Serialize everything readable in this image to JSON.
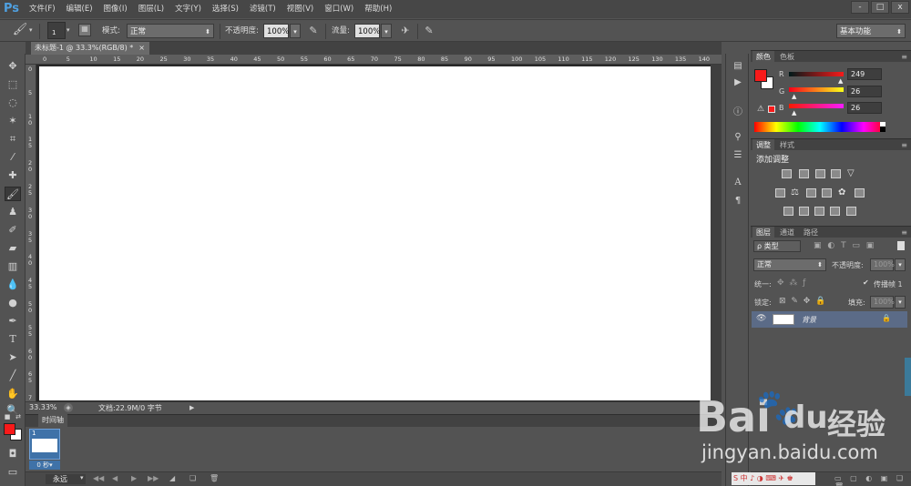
{
  "app": {
    "logo": "Ps"
  },
  "menu": [
    "文件(F)",
    "编辑(E)",
    "图像(I)",
    "图层(L)",
    "文字(Y)",
    "选择(S)",
    "滤镜(T)",
    "视图(V)",
    "窗口(W)",
    "帮助(H)"
  ],
  "window_controls": [
    "-",
    "□",
    "x"
  ],
  "options": {
    "brush_size": "1",
    "mode_label": "模式:",
    "mode_value": "正常",
    "opacity_label": "不透明度:",
    "opacity_value": "100%",
    "flow_label": "流量:",
    "flow_value": "100%",
    "workspace": "基本功能"
  },
  "document": {
    "tab_title": "未标题-1 @ 33.3%(RGB/8) *",
    "tab_close": "×"
  },
  "ruler": {
    "h_labels": [
      "0",
      "5",
      "10",
      "15",
      "20",
      "25",
      "30",
      "35",
      "40",
      "45",
      "50",
      "55",
      "60",
      "65",
      "70",
      "75",
      "80",
      "85",
      "90",
      "95",
      "100",
      "105",
      "110",
      "115",
      "120",
      "125",
      "130",
      "135",
      "140",
      "14"
    ],
    "v_labels": [
      "0",
      "5",
      "1\n0",
      "1\n5",
      "2\n0",
      "2\n5",
      "3\n0",
      "3\n5",
      "4\n0",
      "4\n5",
      "5\n0",
      "5\n5",
      "6\n0",
      "6\n5",
      "7\n0"
    ]
  },
  "status": {
    "zoom": "33.33%",
    "doc_info": "文档:22.9M/0 字节"
  },
  "timeline": {
    "tab": "时间轴",
    "frame_number": "1",
    "frame_delay": "0 秒▾",
    "loop": "永远"
  },
  "color_panel": {
    "tabs": [
      "颜色",
      "色板"
    ],
    "channels": [
      {
        "label": "R",
        "value": "249"
      },
      {
        "label": "G",
        "value": "26"
      },
      {
        "label": "B",
        "value": "26"
      }
    ],
    "fg_color": "#f91a1a",
    "bg_color": "#ffffff"
  },
  "adjustments_panel": {
    "tabs": [
      "调整",
      "样式"
    ],
    "title": "添加调整"
  },
  "layers_panel": {
    "tabs": [
      "图层",
      "通道",
      "路径"
    ],
    "filter_kind": "ρ 类型",
    "blend_mode": "正常",
    "opacity_label": "不透明度:",
    "opacity_value": "100%",
    "unify_label": "统一:",
    "propagate_label": "传播帧 1",
    "lock_label": "锁定:",
    "fill_label": "填充:",
    "fill_value": "100%",
    "layers": [
      {
        "name": "背景",
        "visible": true,
        "locked": true
      }
    ]
  },
  "watermark": {
    "brand": "Bai",
    "brand2": "du",
    "cn": "经验",
    "url": "jingyan.baidu.com"
  },
  "icons": {
    "toolbar": [
      "move-icon",
      "marquee-icon",
      "lasso-icon",
      "quick-select-icon",
      "crop-icon",
      "eyedropper-icon",
      "healing-icon",
      "brush-icon",
      "stamp-icon",
      "history-brush-icon",
      "eraser-icon",
      "gradient-icon",
      "blur-icon",
      "dodge-icon",
      "pen-icon",
      "type-icon",
      "path-select-icon",
      "line-icon",
      "hand-icon",
      "zoom-icon"
    ]
  }
}
